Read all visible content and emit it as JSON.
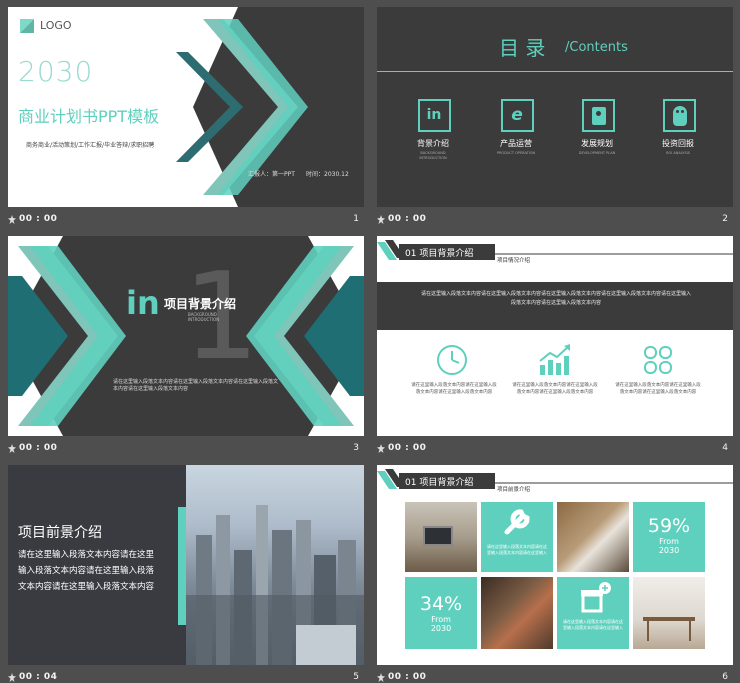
{
  "colors": {
    "teal": "#5fd0be",
    "teal_dark": "#1e6e74",
    "dark": "#3c3b3b",
    "bg": "#4e4e4e"
  },
  "slides": [
    {
      "number": "1",
      "time": "00 : 00",
      "logo": "LOGO",
      "year": "2030",
      "title": "商业计划书PPT模板",
      "subtitle": "商务商业/活动策划/工作汇报/毕业答辩/求职招聘",
      "reporter": "汇报人：第一PPT",
      "date": "时间：2030.12"
    },
    {
      "number": "2",
      "time": "00 : 00",
      "toc_title": "目 录",
      "toc_sub": "/Contents",
      "items": [
        {
          "icon": "in",
          "icon_name": "linkedin-icon",
          "label": "背景介绍",
          "sub1": "BACKGROUND",
          "sub2": "INTRODUCTION"
        },
        {
          "icon": "e",
          "icon_name": "ie-browser-icon",
          "label": "产品运营",
          "sub1": "PRODUCT OPERATION",
          "sub2": ""
        },
        {
          "icon": "",
          "icon_name": "finder-icon",
          "label": "发展规划",
          "sub1": "DEVELOPMENT PLAN",
          "sub2": ""
        },
        {
          "icon": "",
          "icon_name": "penguin-icon",
          "label": "投资回报",
          "sub1": "ROI ANALYSIS",
          "sub2": ""
        }
      ]
    },
    {
      "number": "3",
      "time": "00 : 00",
      "icon": "in",
      "big_number": "1",
      "title": "项目背景介绍",
      "sub1": "BACKGROUND",
      "sub2": "INTRODUCTION",
      "body1": "请在这里输入段落文本内容请在这里输入段落文本内容请在这里输入段落文",
      "body2": "本内容请在这里输入段落文本内容"
    },
    {
      "number": "4",
      "time": "00 : 00",
      "heading": "01 项目背景介绍",
      "tag": "项目情况介绍",
      "band_text": "请在这里输入段落文本内容请在这里输入段落文本内容请在这里输入段落文本内容请在这里输入段落文本内容请在这里输入段落文本内容请在这里输入段落文本内容",
      "cols": [
        {
          "icon_name": "clock-icon",
          "text": "请在这里输入段落文本内容请在这里输入段落文本内容请在这里输入段落文本内容"
        },
        {
          "icon_name": "growth-chart-icon",
          "text": "请在这里输入段落文本内容请在这里输入段落文本内容请在这里输入段落文本内容"
        },
        {
          "icon_name": "clover-icon",
          "text": "请在这里输入段落文本内容请在这里输入段落文本内容请在这里输入段落文本内容"
        }
      ]
    },
    {
      "number": "5",
      "time": "00 : 04",
      "title": "项目前景介绍",
      "body": "请在这里输入段落文本内容请在这里输入段落文本内容请在这里输入段落文本内容请在这里输入段落文本内容"
    },
    {
      "number": "6",
      "time": "00 : 00",
      "heading": "01 项目背景介绍",
      "tag": "项目前景介绍",
      "tile_text": "请在这里输入段落文本内容请在这里输入段落文本内容请在这里输入",
      "stat1": {
        "value": "59%",
        "from": "From",
        "year": "2030"
      },
      "stat2": {
        "value": "34%",
        "from": "From",
        "year": "2030"
      }
    }
  ]
}
